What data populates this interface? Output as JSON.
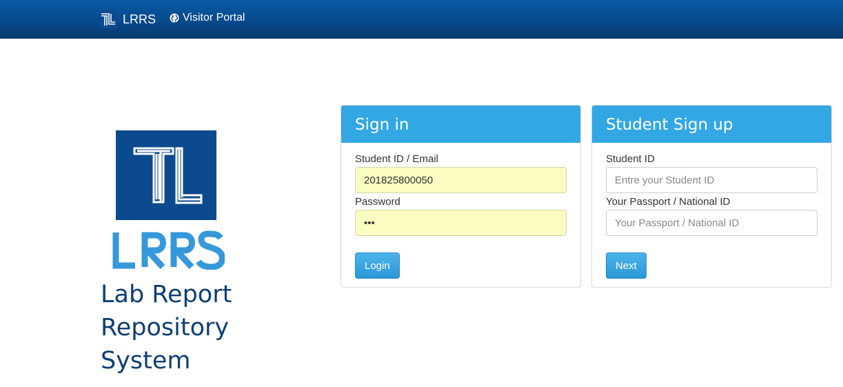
{
  "navbar": {
    "brand": {
      "text": "LRRS",
      "icon": "tl-logo-icon"
    },
    "links": [
      {
        "label": "Visitor Portal",
        "icon": "globe-icon"
      }
    ],
    "colors": {
      "background": "#074a8c",
      "text": "#ffffff"
    }
  },
  "hero": {
    "logo_icon": "tl-logo-icon",
    "wordmark": "LRRS",
    "title_lines": [
      "Lab Report",
      "Repository",
      "System"
    ],
    "colors": {
      "logo_bg": "#0b4a8f",
      "wordmark": "#3498db",
      "title": "#0f3e74"
    }
  },
  "signin": {
    "heading": "Sign in",
    "id_label": "Student ID / Email",
    "id_value": "201825800050",
    "password_label": "Password",
    "password_value": "abc",
    "submit_label": "Login"
  },
  "signup": {
    "heading": "Student Sign up",
    "id_label": "Student ID",
    "id_placeholder": "Entre your Student ID",
    "passport_label": "Your Passport / National ID",
    "passport_placeholder": "Your Passport / National ID",
    "submit_label": "Next"
  },
  "colors": {
    "panel_heading": "#33a7e4",
    "button": "#2c98d8",
    "autofill": "#fafcc2"
  }
}
